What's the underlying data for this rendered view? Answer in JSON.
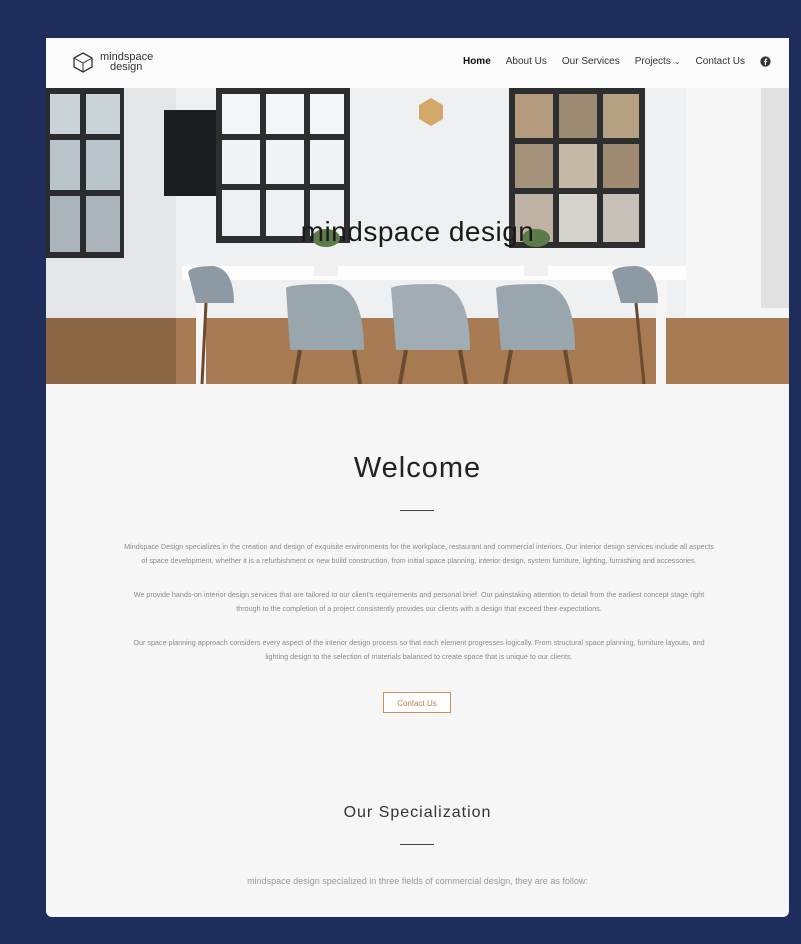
{
  "header": {
    "logo": {
      "line1": "mindspace",
      "line2": "design"
    },
    "nav": [
      {
        "label": "Home",
        "active": true
      },
      {
        "label": "About Us"
      },
      {
        "label": "Our Services"
      },
      {
        "label": "Projects",
        "has_dropdown": true
      },
      {
        "label": "Contact Us"
      }
    ],
    "social_icon": "facebook-icon"
  },
  "hero": {
    "title": "mindspace design"
  },
  "welcome": {
    "heading": "Welcome",
    "paragraphs": [
      "Mindspace Design specializes in the creation and design of exquisite environments for the workplace, restaurant and commercial interiors. Our interior design services include all aspects of space development, whether it is a refurbishment or new build construction, from initial space planning, interior design, system furniture, lighting, furnishing and accessories.",
      "We provide hands-on interior design services that are tailored to our client's requirements and personal brief. Our painstaking attention to detail from the earliest concept stage right through to the completion of a project consistently provides our clients with a design that exceed their expectations.",
      "Our space planning approach considers every aspect of the interior design process so that each element progresses logically. From structural space planning, furniture layouts, and lighting design to the selection of materials balanced to create space that is unique to our clients."
    ],
    "button_label": "Contact Us"
  },
  "specialization": {
    "heading": "Our Specialization",
    "subtitle": "mindspace design specialized in three fields of commercial design, they are as follow:"
  },
  "colors": {
    "page_bg": "#1f2d5c",
    "accent": "#c9925a"
  }
}
